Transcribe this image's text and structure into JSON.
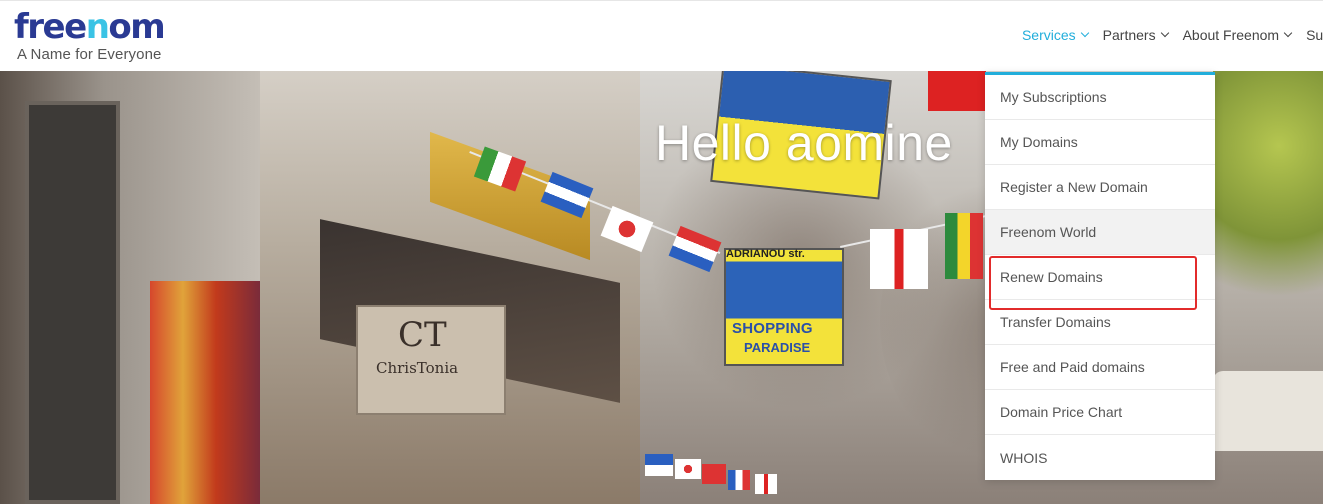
{
  "brand": {
    "logo_prefix": "free",
    "logo_o": "n",
    "logo_suffix": "om",
    "tagline": "A Name for Everyone"
  },
  "nav": {
    "items": [
      {
        "label": "Services",
        "active": true
      },
      {
        "label": "Partners",
        "active": false
      },
      {
        "label": "About Freenom",
        "active": false
      },
      {
        "label": "Sup",
        "active": false
      }
    ]
  },
  "hero": {
    "greeting": "Hello aomine",
    "sign_main": "CT",
    "sign_sub": "ChrisTonia",
    "banner_top": "ADRIANOU str.",
    "banner_word1": "SHOPPING",
    "banner_word2": "PARADISE"
  },
  "services_menu": {
    "items": [
      "My Subscriptions",
      "My Domains",
      "Register a New Domain",
      "Freenom World",
      "Renew Domains",
      "Transfer Domains",
      "Free and Paid domains",
      "Domain Price Chart",
      "WHOIS"
    ],
    "hovered_item": "Freenom World",
    "highlighted_item": "Renew Domains"
  },
  "colors": {
    "accent": "#22aedb",
    "logo_dark": "#2a3a93",
    "highlight_box": "#e22b2b"
  }
}
